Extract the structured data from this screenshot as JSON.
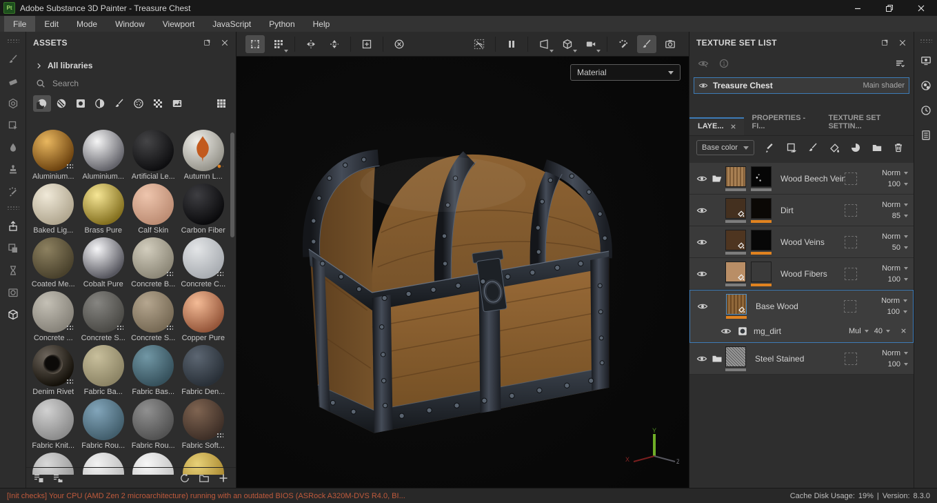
{
  "colors": {
    "accent_blue": "#3d7cb8",
    "accent_orange": "#e0821f",
    "warning_text": "#c05a3c",
    "axis_green": "#6fae27",
    "axis_red": "#8a2525",
    "axis_grey": "#8a8a8a"
  },
  "window": {
    "app_badge": "Pt",
    "title": "Adobe Substance 3D Painter - Treasure Chest"
  },
  "menu_bar": {
    "items": [
      "File",
      "Edit",
      "Mode",
      "Window",
      "Viewport",
      "JavaScript",
      "Python",
      "Help"
    ],
    "active_item": "File"
  },
  "left_toolbar": {
    "tools": [
      "paint-brush",
      "eraser",
      "projection",
      "polygon-fill",
      "smudge",
      "clone-stamp",
      "particle-brush"
    ],
    "resources": [
      "export-mesh",
      "geometry-decal",
      "measure",
      "bake",
      "shelf"
    ]
  },
  "viewport_toolbar": {
    "groups": [
      [
        "symmetry-settings",
        "tiling-mode"
      ],
      [
        "mirror-x",
        "mirror-y"
      ],
      [
        "pivot-frame"
      ],
      [
        "reset-transform"
      ]
    ],
    "right_groups": [
      [
        "hide-ui-helpers"
      ],
      [
        "pause-engine"
      ],
      [
        "display-rasterization",
        "display-geometry",
        "display-camera"
      ],
      [
        "particle-tools",
        "paint-tool",
        "screenshot"
      ]
    ],
    "active": [
      "symmetry-settings",
      "paint-tool"
    ],
    "carets": [
      "tiling-mode",
      "display-rasterization",
      "display-geometry",
      "display-camera"
    ]
  },
  "assets_panel": {
    "title": "ASSETS",
    "breadcrumb": "All libraries",
    "search_placeholder": "Search",
    "filters": [
      "materials",
      "smart-materials",
      "smart-masks",
      "filters",
      "brushes",
      "alphas",
      "patterns",
      "textures"
    ],
    "active_filter": "materials",
    "view_icon": "grid-view",
    "footer_left": [
      "import-list",
      "library-list"
    ],
    "footer_right": [
      "reload-shelf",
      "new-folder",
      "add-resource"
    ],
    "materials": [
      {
        "name": "Aluminium...",
        "c1": "#e9b75f",
        "c2": "#6e4410",
        "badge": true
      },
      {
        "name": "Aluminium...",
        "c1": "#f5f5f5",
        "c2": "#63636a"
      },
      {
        "name": "Artificial Le...",
        "c1": "#454547",
        "c2": "#0e0e10"
      },
      {
        "name": "Autumn L...",
        "c1": "#efeee9",
        "c2": "#97958c",
        "leaf": true,
        "badge_orange": true
      },
      {
        "name": "Baked Lig...",
        "c1": "#f0e9d8",
        "c2": "#b1a790"
      },
      {
        "name": "Brass Pure",
        "c1": "#f6e695",
        "c2": "#84701f"
      },
      {
        "name": "Calf Skin",
        "c1": "#eec5ad",
        "c2": "#bd8d74"
      },
      {
        "name": "Carbon Fiber",
        "c1": "#3e3e42",
        "c2": "#0a0a0c"
      },
      {
        "name": "Coated Me...",
        "c1": "#8d8160",
        "c2": "#49412c"
      },
      {
        "name": "Cobalt Pure",
        "c1": "#f6f6f8",
        "c2": "#56565e"
      },
      {
        "name": "Concrete B...",
        "c1": "#d2cdbd",
        "c2": "#8c8777",
        "badge": true
      },
      {
        "name": "Concrete C...",
        "c1": "#e3e5e7",
        "c2": "#a9adb2",
        "badge": true
      },
      {
        "name": "Concrete ...",
        "c1": "#c4c0b5",
        "c2": "#87837a",
        "badge": true
      },
      {
        "name": "Concrete S...",
        "c1": "#868581",
        "c2": "#4b4a46",
        "badge": true
      },
      {
        "name": "Concrete S...",
        "c1": "#b5a68f",
        "c2": "#776a55",
        "badge": true
      },
      {
        "name": "Copper Pure",
        "c1": "#f4bb96",
        "c2": "#95563a"
      },
      {
        "name": "Denim Rivet",
        "c1": "#6e665d",
        "c2": "#141009",
        "rivet": true,
        "badge": true
      },
      {
        "name": "Fabric Ba...",
        "c1": "#c8bf9c",
        "c2": "#8c8465"
      },
      {
        "name": "Fabric Bas...",
        "c1": "#7197a5",
        "c2": "#36515c"
      },
      {
        "name": "Fabric Den...",
        "c1": "#5c6672",
        "c2": "#293038"
      },
      {
        "name": "Fabric Knit...",
        "c1": "#d1d1d1",
        "c2": "#8b8b8b"
      },
      {
        "name": "Fabric Rou...",
        "c1": "#82a5ba",
        "c2": "#425e6c"
      },
      {
        "name": "Fabric Rou...",
        "c1": "#909090",
        "c2": "#525252"
      },
      {
        "name": "Fabric Soft...",
        "c1": "#7f6451",
        "c2": "#3e2f27",
        "badge": true
      },
      {
        "name": "",
        "c1": "#d9d9d9",
        "c2": "#9a9a9a"
      },
      {
        "name": "",
        "c1": "#f2f2f2",
        "c2": "#bdbdbd"
      },
      {
        "name": "",
        "c1": "#f7f7f7",
        "c2": "#c4c4c4"
      },
      {
        "name": "",
        "c1": "#e8d178",
        "c2": "#a8872e"
      }
    ]
  },
  "viewport": {
    "shading_dropdown": "Material",
    "gizmo": {
      "x": "X",
      "y": "Y",
      "z": "Z"
    }
  },
  "texture_set_list": {
    "title": "TEXTURE SET LIST",
    "toolbar": [
      "toggle-all-visibility",
      "solo-visibility"
    ],
    "set": {
      "name": "Treasure Chest",
      "shader": "Main shader",
      "selected": true
    }
  },
  "layers_panel": {
    "tabs": [
      {
        "label": "LAYE...",
        "active": true,
        "closable": true
      },
      {
        "label": "PROPERTIES - FI...",
        "active": false,
        "closable": false
      },
      {
        "label": "TEXTURE SET SETTIN...",
        "active": false,
        "closable": false
      }
    ],
    "channel_value": "Base color",
    "actions": [
      "add-effect",
      "add-fill-layer",
      "add-paint-layer",
      "add-fill",
      "add-smart-material",
      "add-group",
      "delete-layer"
    ],
    "layers": [
      {
        "name": "Wood Beech Veined",
        "blend": "Norm",
        "opacity": "100",
        "folder": "open",
        "thumbs": [
          {
            "c": "#a3794a",
            "tex": "wood"
          },
          {
            "c": "#060606",
            "tex": "speckle"
          }
        ],
        "bars": [
          "grey",
          "grey"
        ]
      },
      {
        "name": "Dirt",
        "blend": "Norm",
        "opacity": "85",
        "thumbs": [
          {
            "c": "#44301f",
            "bucket": true
          },
          {
            "c": "#0b0805"
          }
        ],
        "bars": [
          "grey",
          "orange"
        ]
      },
      {
        "name": "Wood Veins",
        "blend": "Norm",
        "opacity": "50",
        "thumbs": [
          {
            "c": "#4e3520",
            "bucket": true
          },
          {
            "c": "#070707"
          }
        ],
        "bars": [
          "grey",
          "orange"
        ]
      },
      {
        "name": "Wood Fibers",
        "blend": "Norm",
        "opacity": "100",
        "thumbs": [
          {
            "c": "#b98e66",
            "bucket": true
          },
          {
            "c": "#3a3a3a"
          }
        ],
        "bars": [
          "grey",
          "orange"
        ]
      },
      {
        "name": "Base Wood",
        "blend": "Norm",
        "opacity": "100",
        "selected": true,
        "thumbs": [
          {
            "c": "#8a6030",
            "tex": "wood",
            "bucket": true,
            "selected": true
          }
        ],
        "bars": [
          "orange"
        ],
        "effects": [
          {
            "name": "mg_dirt",
            "blend": "Mul",
            "opacity": "40"
          }
        ]
      },
      {
        "name": "Steel Stained",
        "blend": "Norm",
        "opacity": "100",
        "folder": "closed",
        "thumbs": [
          {
            "c": "#949494",
            "tex": "noise"
          }
        ],
        "bars": [
          "grey"
        ]
      }
    ]
  },
  "status_bar": {
    "message": "[Init checks] Your CPU (AMD Zen 2 microarchitecture) running with an outdated BIOS (ASRock A320M-DVS R4.0, BI...",
    "cache_label": "Cache Disk Usage:",
    "cache_value": "19%",
    "separator": "|",
    "version_label": "Version:",
    "version_value": "8.3.0"
  }
}
